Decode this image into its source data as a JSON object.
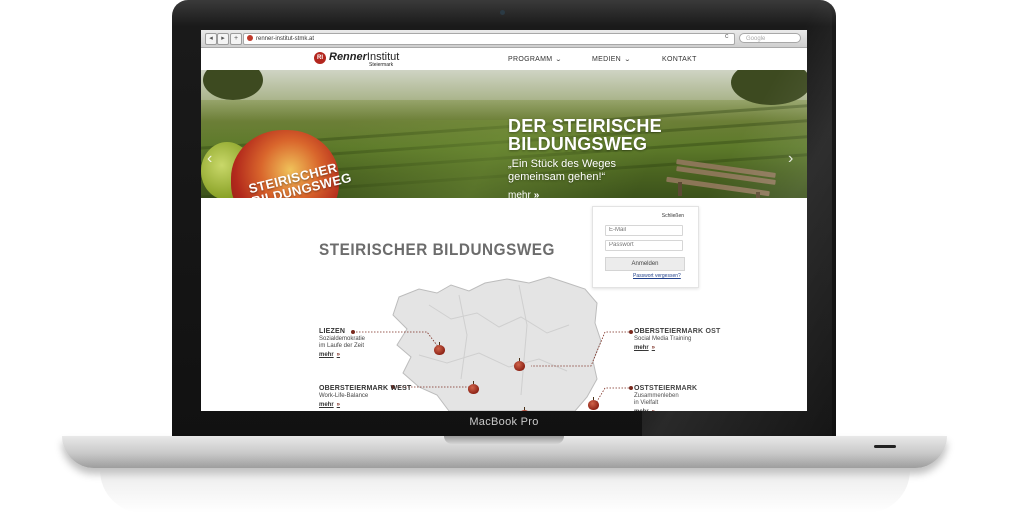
{
  "laptop": {
    "brand": "MacBook Pro"
  },
  "browser": {
    "back_label": "◂",
    "forward_label": "▸",
    "add_label": "+",
    "url": "renner-institut-stmk.at",
    "reload_label": "c",
    "search_placeholder": "Google"
  },
  "site": {
    "logo": {
      "badge": "RI",
      "name_bold": "Renner",
      "name_rest": "Institut",
      "sub": "Steiermark"
    },
    "menu": [
      {
        "label": "PROGRAMM",
        "has_dropdown": true
      },
      {
        "label": "MEDIEN",
        "has_dropdown": true
      },
      {
        "label": "KONTAKT",
        "has_dropdown": false
      }
    ],
    "chevron": "⌄"
  },
  "hero": {
    "title_line1": "DER STEIRISCHE",
    "title_line2": "BILDUNGSWEG",
    "quote": "„Ein Stück des Weges gemeinsam gehen!“",
    "more": "mehr",
    "more_arrow": "»",
    "apple_line1": "STEIRISCHER",
    "apple_line2": "BILDUNGSWEG",
    "prev": "‹",
    "next": "›"
  },
  "login": {
    "close": "Schließen",
    "email_placeholder": "E-Mail",
    "password_placeholder": "Passwort",
    "submit": "Anmelden",
    "forgot": "Passwort vergessen?"
  },
  "section": {
    "title": "STEIRISCHER BILDUNGSWEG"
  },
  "regions": [
    {
      "name": "LIEZEN",
      "desc_line1": "Sozialdemokratie",
      "desc_line2": "im Laufe der Zeit",
      "more": "mehr",
      "arrow": "»"
    },
    {
      "name": "OBERSTEIERMARK WEST",
      "desc_line1": "Work-Life-Balance",
      "desc_line2": "",
      "more": "mehr",
      "arrow": "»"
    },
    {
      "name": "OBERSTEIERMARK OST",
      "desc_line1": "Social Media Training",
      "desc_line2": "",
      "more": "mehr",
      "arrow": "»"
    },
    {
      "name": "OSTSTEIERMARK",
      "desc_line1": "Zusammenleben",
      "desc_line2": "in Vielfalt",
      "more": "mehr",
      "arrow": "»"
    }
  ],
  "colors": {
    "accent": "#7a2a1e",
    "logo_red": "#b3261e"
  }
}
